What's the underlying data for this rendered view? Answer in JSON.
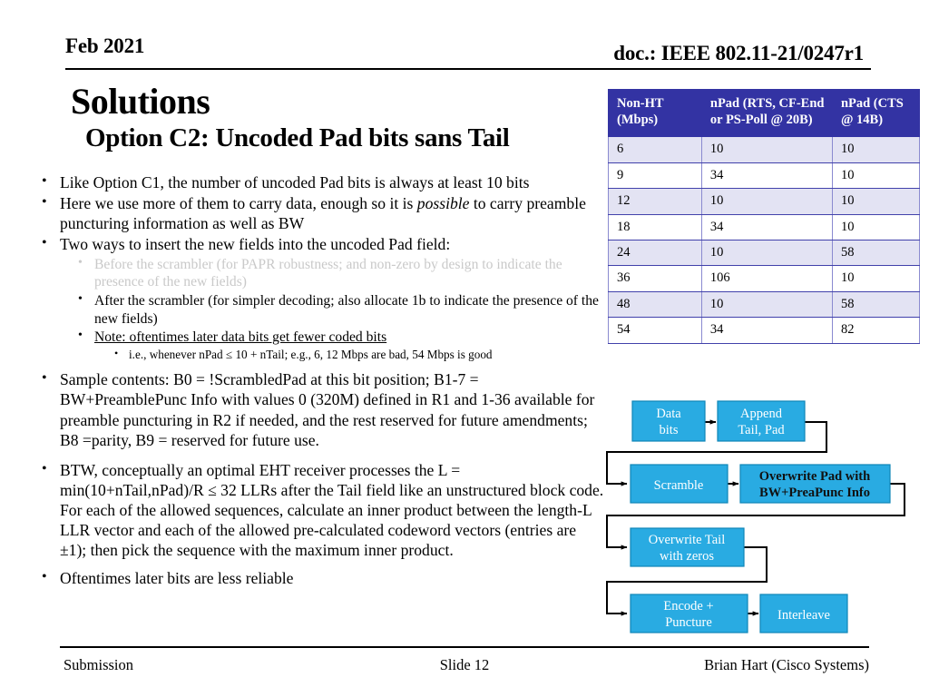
{
  "header": {
    "date": "Feb 2021",
    "doc": "doc.: IEEE 802.11-21/0247r1"
  },
  "title": {
    "main": "Solutions",
    "subtitle": "Option C2: Uncoded Pad bits sans Tail"
  },
  "bullets": {
    "b1": "Like Option C1, the number of uncoded Pad bits is always at least 10 bits",
    "b2_pre": "Here we use more of them to carry data, enough so it is ",
    "b2_italic": "possible",
    "b2_post": " to carry preamble puncturing information as well as BW",
    "b3": "Two ways to insert the new fields into the uncoded Pad field:",
    "s1": "Before the scrambler (for PAPR robustness; and non-zero by design to indicate the presence of the new fields)",
    "s2": "After the scrambler (for simpler decoding; also allocate 1b to indicate the presence of the new fields)",
    "s3": "Note: oftentimes later data bits get fewer coded bits",
    "s3a": "i.e., whenever nPad ≤ 10 + nTail; e.g., 6, 12 Mbps are bad, 54 Mbps is good",
    "b4": "Sample contents: B0 = !ScrambledPad at this bit position; B1-7 = BW+PreamblePunc Info with values 0 (320M) defined in R1 and 1-36 available for preamble puncturing in R2 if needed, and the rest reserved for future amendments; B8 =parity, B9 = reserved for future use.",
    "b5": "BTW, conceptually an optimal EHT receiver processes the L = min(10+nTail,nPad)/R ≤ 32 LLRs after the Tail field like an unstructured block code. For each of the allowed sequences, calculate an inner product between the length-L LLR vector and each of the allowed pre-calculated codeword vectors (entries are ±1); then pick the sequence with the maximum inner product.",
    "b6": "Oftentimes later bits are less reliable",
    "marker": "•"
  },
  "table": {
    "headers": [
      "Non-HT (Mbps)",
      "nPad (RTS, CF-End or PS-Poll @ 20B)",
      "nPad (CTS @ 14B)"
    ],
    "rows": [
      [
        "6",
        "10",
        "10"
      ],
      [
        "9",
        "34",
        "10"
      ],
      [
        "12",
        "10",
        "10"
      ],
      [
        "18",
        "34",
        "10"
      ],
      [
        "24",
        "10",
        "58"
      ],
      [
        "36",
        "106",
        "10"
      ],
      [
        "48",
        "10",
        "58"
      ],
      [
        "54",
        "34",
        "82"
      ]
    ],
    "header_bg": "#3333A3",
    "row_alt_bg": "#E3E3F3"
  },
  "flow": {
    "box_color": "#29ABE2",
    "boxes": [
      {
        "id": "data-bits",
        "lines": [
          "Data",
          "bits"
        ],
        "dark": false
      },
      {
        "id": "append-tail-pad",
        "lines": [
          "Append",
          "Tail, Pad"
        ],
        "dark": false
      },
      {
        "id": "scramble",
        "lines": [
          "Scramble"
        ],
        "dark": false
      },
      {
        "id": "overwrite-pad",
        "lines": [
          "Overwrite Pad with",
          "BW+PreaPunc Info"
        ],
        "dark": true
      },
      {
        "id": "overwrite-tail",
        "lines": [
          "Overwrite Tail",
          "with zeros"
        ],
        "dark": false
      },
      {
        "id": "encode-puncture",
        "lines": [
          "Encode +",
          "Puncture"
        ],
        "dark": false
      },
      {
        "id": "interleave",
        "lines": [
          "Interleave"
        ],
        "dark": false
      }
    ]
  },
  "footer": {
    "submission": "Submission",
    "slide": "Slide 12",
    "author": "Brian Hart (Cisco Systems)"
  }
}
